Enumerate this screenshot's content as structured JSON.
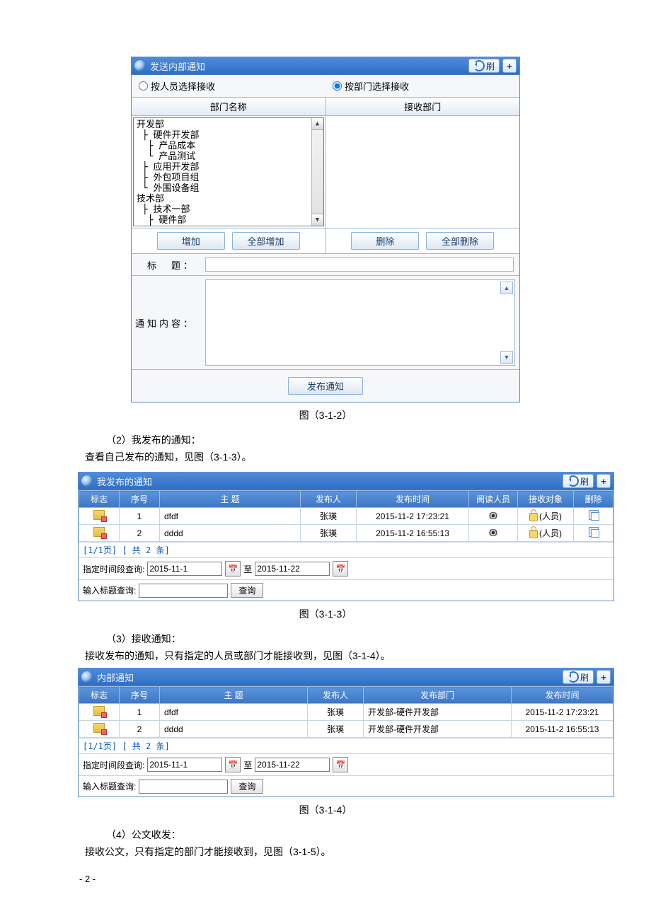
{
  "panel1": {
    "title": "发送内部通知",
    "refresh": "刷",
    "radio_person": "按人员选择接收",
    "radio_dept": "按部门选择接收",
    "col_left": "部门名称",
    "col_right": "接收部门",
    "tree": "开发部\n ├ 硬件开发部\n  ├ 产品成本\n  └ 产品测试\n ├ 应用开发部\n ├ 外包项目组\n └ 外围设备组\n技术部\n ├ 技术一部\n  ├ 硬件部\n  └ 软件部",
    "btn_add": "增加",
    "btn_addall": "全部增加",
    "btn_del": "删除",
    "btn_delall": "全部删除",
    "label_title": "标　题：",
    "label_content": "通知内容：",
    "btn_publish": "发布通知"
  },
  "cap1": "图（3-1-2）",
  "text1a": "（2）我发布的通知：",
  "text1b": "查看自己发布的通知，见图（3-1-3）。",
  "panel2": {
    "title": "我发布的通知",
    "refresh": "刷",
    "headers": [
      "标志",
      "序号",
      "主 题",
      "发布人",
      "发布时间",
      "阅读人员",
      "接收对象",
      "删除"
    ],
    "rows": [
      {
        "seq": "1",
        "subj": "dfdf",
        "pub": "张瑛",
        "time": "2015-11-2 17:23:21",
        "recv": "(人员)"
      },
      {
        "seq": "2",
        "subj": "dddd",
        "pub": "张瑛",
        "time": "2015-11-2 16:55:13",
        "recv": "(人员)"
      }
    ],
    "pager": "[1/1页] [ 共 2 条]",
    "s_label": "指定时间段查询:",
    "s_from": "2015-11-1",
    "s_to_label": "至",
    "s_to": "2015-11-22",
    "t_label": "输入标题查询:",
    "btn_query": "查询"
  },
  "cap2": "图（3-1-3）",
  "text2a": "（3）接收通知：",
  "text2b": "接收发布的通知，只有指定的人员或部门才能接收到，见图（3-1-4）。",
  "panel3": {
    "title": "内部通知",
    "refresh": "刷",
    "headers": [
      "标志",
      "序号",
      "主 题",
      "发布人",
      "发布部门",
      "发布时间"
    ],
    "rows": [
      {
        "seq": "1",
        "subj": "dfdf",
        "pub": "张瑛",
        "dept": "开发部-硬件开发部",
        "time": "2015-11-2 17:23:21"
      },
      {
        "seq": "2",
        "subj": "dddd",
        "pub": "张瑛",
        "dept": "开发部-硬件开发部",
        "time": "2015-11-2 16:55:13"
      }
    ],
    "pager": "[1/1页] [ 共 2 条]",
    "s_label": "指定时间段查询:",
    "s_from": "2015-11-1",
    "s_to_label": "至",
    "s_to": "2015-11-22",
    "t_label": "输入标题查询:",
    "btn_query": "查询"
  },
  "cap3": "图（3-1-4）",
  "text3a": "（4）公文收发：",
  "text3b": "接收公文，只有指定的部门才能接收到，见图（3-1-5）。",
  "pagenum": "- 2 -"
}
